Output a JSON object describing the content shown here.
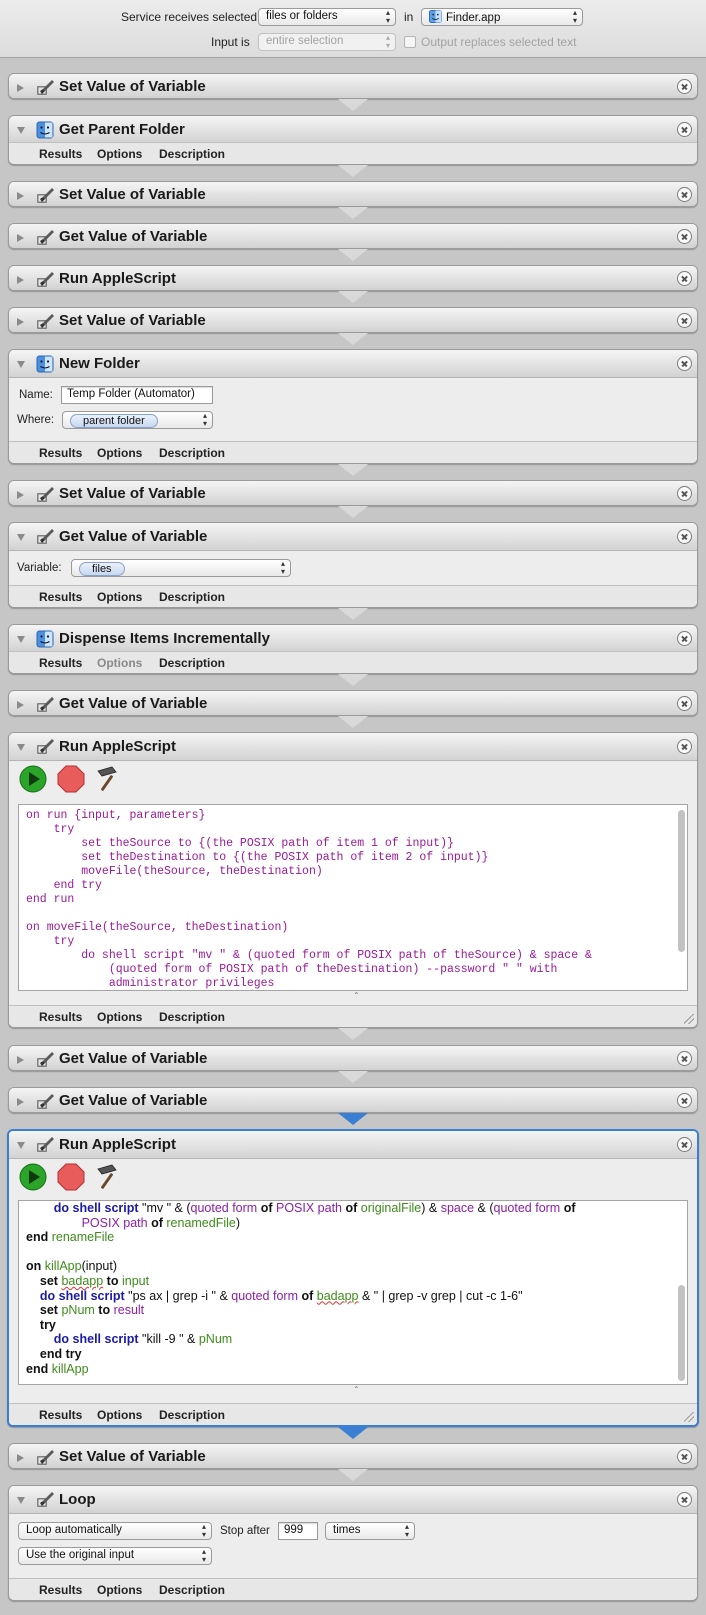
{
  "header": {
    "receives_label": "Service receives selected",
    "receives_value": "files or folders",
    "in_label": "in",
    "app_value": "Finder.app",
    "input_label": "Input is",
    "input_value": "entire selection",
    "replaces_label": "Output replaces selected text"
  },
  "tabs": {
    "results": "Results",
    "options": "Options",
    "description": "Description"
  },
  "actions": {
    "a1": {
      "title": "Set Value of Variable"
    },
    "a2": {
      "title": "Get Parent Folder"
    },
    "a3": {
      "title": "Set Value of Variable"
    },
    "a4": {
      "title": "Get Value of Variable"
    },
    "a5": {
      "title": "Run AppleScript"
    },
    "a6": {
      "title": "Set Value of Variable"
    },
    "a7": {
      "title": "New Folder",
      "name_label": "Name:",
      "name_value": "Temp Folder (Automator)",
      "where_label": "Where:",
      "where_value": "parent folder"
    },
    "a8": {
      "title": "Set Value of Variable"
    },
    "a9": {
      "title": "Get Value of Variable",
      "variable_label": "Variable:",
      "variable_value": "files"
    },
    "a10": {
      "title": "Dispense Items Incrementally"
    },
    "a11": {
      "title": "Get Value of Variable"
    },
    "a12": {
      "title": "Run AppleScript",
      "code": "on run {input, parameters}\n    try\n        set theSource to {(the POSIX path of item 1 of input)}\n        set theDestination to {(the POSIX path of item 2 of input)}\n        moveFile(theSource, theDestination)\n    end try\nend run\n\non moveFile(theSource, theDestination)\n    try\n        do shell script \"mv \" & (quoted form of POSIX path of theSource) & space &\n            (quoted form of POSIX path of theDestination) --password \" \" with\n            administrator privileges"
    },
    "a13": {
      "title": "Get Value of Variable"
    },
    "a14": {
      "title": "Get Value of Variable"
    },
    "a15": {
      "title": "Run AppleScript"
    },
    "a16": {
      "title": "Set Value of Variable"
    },
    "a17": {
      "title": "Loop",
      "loop_value": "Loop automatically",
      "stop_label": "Stop after",
      "stop_value": "999",
      "unit_value": "times",
      "input_value": "Use the original input"
    }
  },
  "script2": {
    "w_do": "do shell script",
    "w_mv": "\"mv \" & (",
    "w_qf": "quoted form",
    "w_of": "of",
    "w_posix": "POSIX path",
    "w_orig": "originalFile",
    "w_amp": ") & ",
    "w_space": "space",
    "w_amp2": " & (",
    "w_renamed": "renamedFile",
    "w_close": ")",
    "w_end": "end",
    "w_renamefile": "renameFile",
    "w_on": "on",
    "w_killapp": "killApp",
    "w_input_paren": "(input)",
    "w_set": "set",
    "w_badapp": "badapp",
    "w_to": "to",
    "w_input": "input",
    "w_ps": "\"ps ax | grep -i \" & ",
    "w_grep": " & \" | grep -v grep | cut -c 1-6\"",
    "w_pnum": "pNum",
    "w_result": "result",
    "w_try": "try",
    "w_kill": "\"kill -9 \" & ",
    "w_endtry": "end try"
  },
  "colors": {
    "selection": "#3a7fd4",
    "keyword_blue": "#1a1aa8",
    "command_purple": "#8b1fa9",
    "variable_green": "#3d8c1a"
  }
}
